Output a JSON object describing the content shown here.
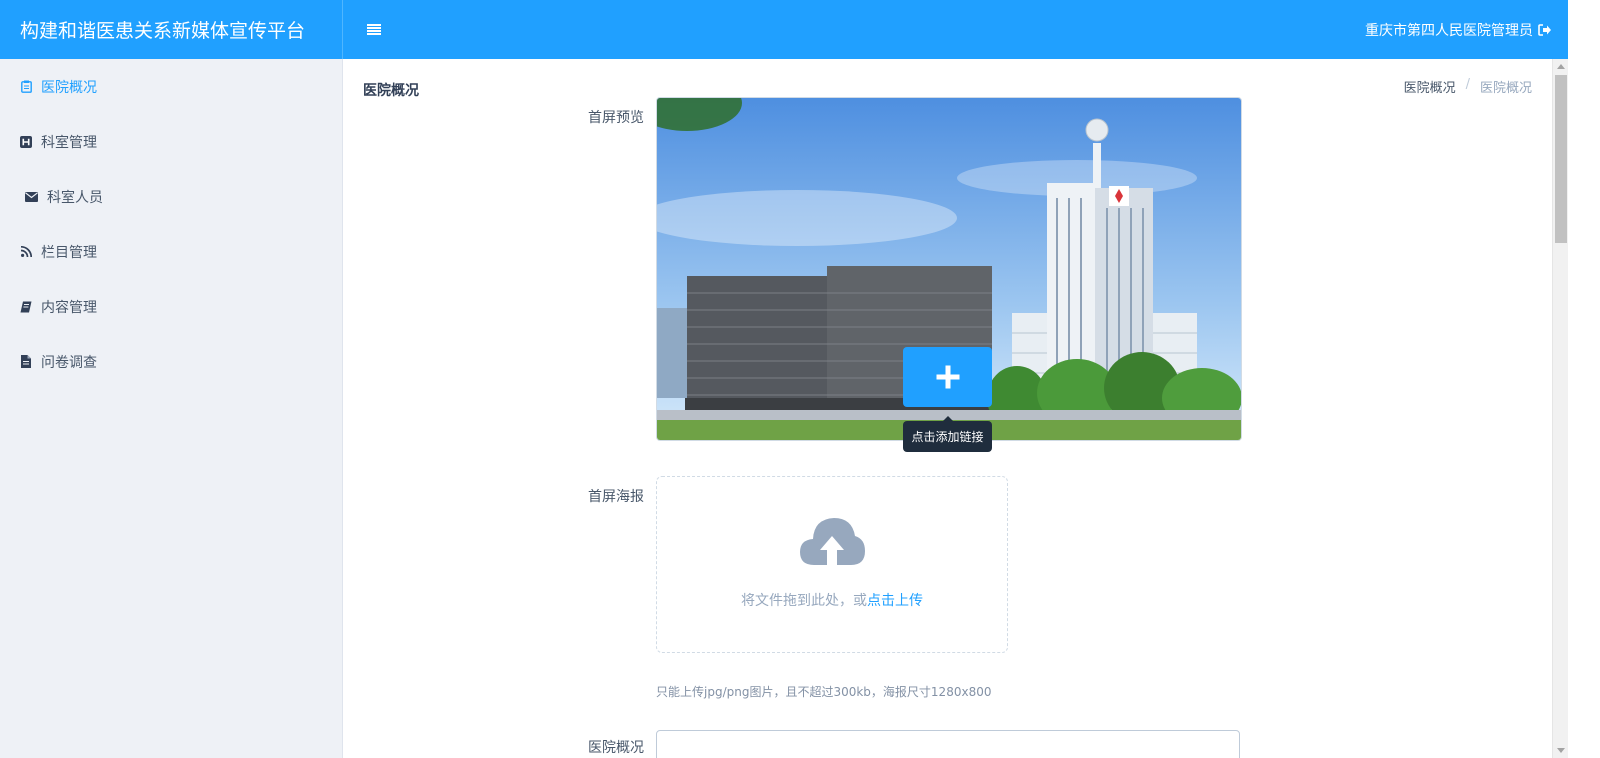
{
  "header": {
    "title": "构建和谐医患关系新媒体宣传平台",
    "user": "重庆市第四人民医院管理员",
    "accent_color": "#20a0ff"
  },
  "sidebar": {
    "items": [
      {
        "label": "医院概况",
        "icon": "clipboard-icon",
        "active": true
      },
      {
        "label": "科室管理",
        "icon": "hospital-h-icon",
        "active": false
      },
      {
        "label": "科室人员",
        "icon": "envelope-icon",
        "active": false
      },
      {
        "label": "栏目管理",
        "icon": "rss-icon",
        "active": false
      },
      {
        "label": "内容管理",
        "icon": "book-icon",
        "active": false
      },
      {
        "label": "问卷调查",
        "icon": "file-icon",
        "active": false
      }
    ]
  },
  "main": {
    "page_title": "医院概况",
    "breadcrumb": [
      "医院概况",
      "医院概况"
    ],
    "breadcrumb_sep": "/",
    "preview_label": "首屏预览",
    "add_link_tooltip": "点击添加链接",
    "poster_label": "首屏海报",
    "upload_text": "将文件拖到此处，或",
    "upload_link": "点击上传",
    "upload_tip": "只能上传jpg/png图片，且不超过300kb，海报尺寸1280x800",
    "intro_label": "医院概况"
  }
}
